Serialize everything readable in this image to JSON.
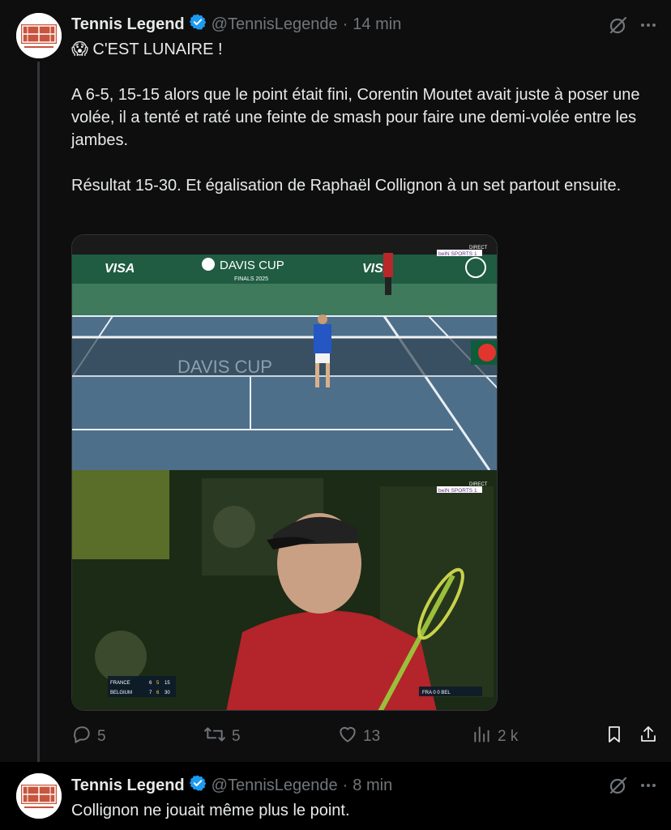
{
  "tweets": [
    {
      "display_name": "Tennis Legend",
      "handle": "@TennisLegende",
      "separator": "·",
      "time": "14 min",
      "text_lines": [
        "😱 C'EST LUNAIRE !",
        "A 6-5, 15-15 alors que le point était fini, Corentin Moutet avait juste à poser une volée, il a tenté et raté une feinte de smash pour faire une demi-volée entre les jambes.",
        "Résultat 15-30. Et égalisation de Raphaël Collignon à un set partout ensuite."
      ],
      "media": {
        "banner_left": "VISA",
        "banner_center": "DAVIS CUP",
        "banner_sub": "FINALS 2025",
        "banner_right": "VISA",
        "net_text": "DAVIS CUP",
        "broadcast_tag": "DIRECT",
        "channel": "beIN SPORTS 1",
        "scoreboard": [
          {
            "team": "FRANCE",
            "sets": "6",
            "games": "5",
            "points": "15"
          },
          {
            "team": "BELGIUM",
            "sets": "7",
            "games": "6",
            "points": "30"
          }
        ],
        "mini_score": "FRA 0 0 BEL"
      },
      "actions": {
        "replies": "5",
        "reposts": "5",
        "likes": "13",
        "views": "2 k"
      }
    },
    {
      "display_name": "Tennis Legend",
      "handle": "@TennisLegende",
      "separator": "·",
      "time": "8 min",
      "text": "Collignon ne jouait même plus le point."
    }
  ],
  "colors": {
    "background": "#000000",
    "tweet_bg": "#0e0e0e",
    "text": "#e7e9ea",
    "muted": "#71767b",
    "verified": "#1d9bf0",
    "avatar_brand": "#c8553d"
  },
  "icons": [
    "verified-badge-icon",
    "grok-icon",
    "more-icon",
    "reply-icon",
    "repost-icon",
    "like-icon",
    "views-icon",
    "bookmark-icon",
    "share-icon"
  ]
}
